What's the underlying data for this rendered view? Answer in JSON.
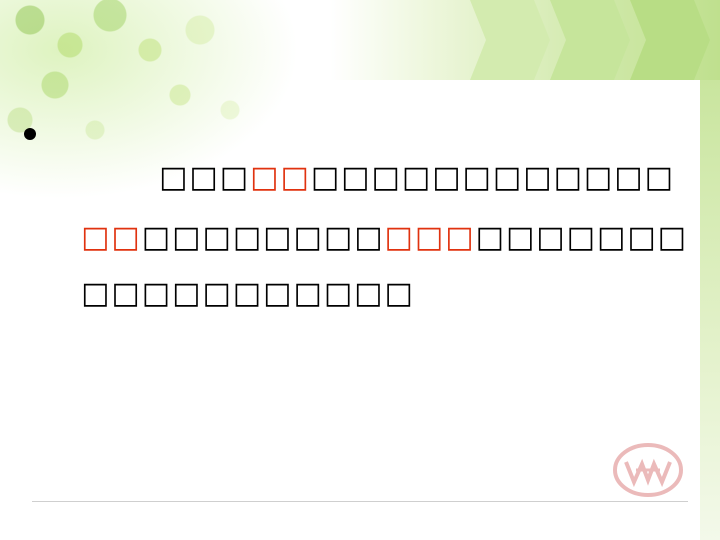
{
  "slide": {
    "line1": {
      "run1": "□□□",
      "run2": "□□",
      "run3": "□□□□□□□□□□□□"
    },
    "line2": {
      "run1": "□□",
      "run2": "□□□□□□□□",
      "run3": "□□□",
      "run4": "□□□□□□□"
    },
    "line3": {
      "run1": "□□□□□□□□□□□"
    }
  },
  "colors": {
    "highlight": "#e0320f",
    "text": "#000000",
    "accent_green": "#c2e293"
  },
  "icons": {
    "bullet": "bullet-dot-icon",
    "logo": "corporate-logo-watermark"
  }
}
